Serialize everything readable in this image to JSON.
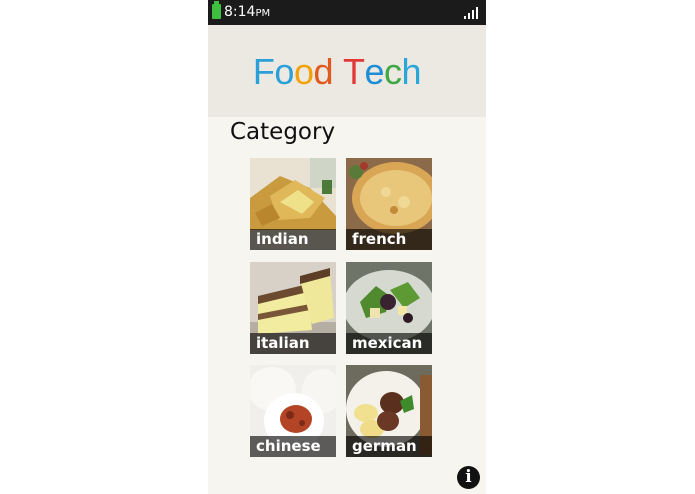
{
  "status_bar": {
    "time": "8:14",
    "ampm": "PM",
    "battery_icon": "battery-icon",
    "signal_icon": "signal-icon"
  },
  "header": {
    "title_letters": [
      "F",
      "o",
      "o",
      "d",
      " ",
      "T",
      "e",
      "c",
      "h"
    ],
    "title_colors": [
      "#2b9fd8",
      "#2b9fd8",
      "#f1a208",
      "#e05a1e",
      "#ffffff",
      "#e23838",
      "#1d8ed6",
      "#40a845",
      "#2ba6d8"
    ]
  },
  "category_heading": "Category",
  "categories": [
    {
      "label": "indian"
    },
    {
      "label": "french"
    },
    {
      "label": "italian"
    },
    {
      "label": "mexican"
    },
    {
      "label": "chinese"
    },
    {
      "label": "german"
    }
  ],
  "info_button": {
    "icon": "info-icon",
    "glyph": "i"
  }
}
